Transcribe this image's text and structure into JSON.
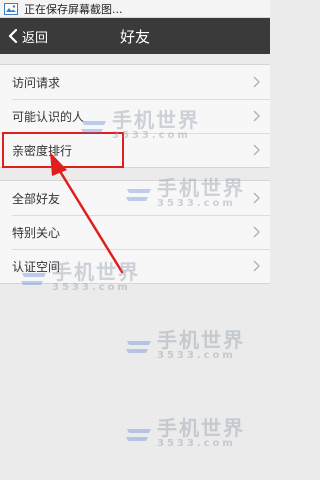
{
  "status_bar": {
    "text": "正在保存屏幕截图..."
  },
  "nav": {
    "back_label": "返回",
    "title": "好友"
  },
  "group1": {
    "items": [
      {
        "label": "访问请求"
      },
      {
        "label": "可能认识的人"
      },
      {
        "label": "亲密度排行"
      }
    ]
  },
  "group2": {
    "items": [
      {
        "label": "全部好友"
      },
      {
        "label": "特别关心"
      },
      {
        "label": "认证空间"
      }
    ]
  },
  "watermark": {
    "brand": "手机世界",
    "number": "3533.com"
  },
  "colors": {
    "nav_bg": "#3a3a3a",
    "highlight": "#e01e1e",
    "watermark_blue": "#4a7fd1"
  }
}
